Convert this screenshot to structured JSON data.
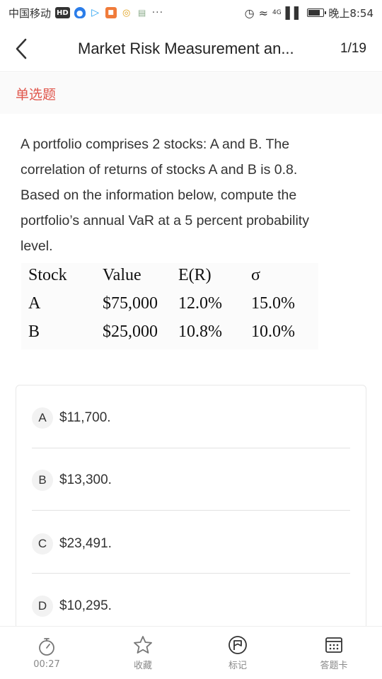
{
  "status_bar": {
    "carrier": "中国移动",
    "hd_badge": "HD",
    "more": "···",
    "network": "4G",
    "time": "晚上8:54",
    "battery_level": 0.85
  },
  "header": {
    "title": "Market Risk Measurement  an...",
    "page_count": "1/19"
  },
  "question_type": "单选题",
  "question": {
    "lines": [
      "A portfolio comprises 2 stocks: A and B. The",
      "correlation of returns of stocks A and B is 0.8.",
      "Based on the information below, compute the",
      "portfolio’s annual VaR at a 5 percent probability",
      "level."
    ],
    "table": {
      "headers": [
        "Stock",
        "Value",
        "E(R)",
        "σ"
      ],
      "rows": [
        [
          "A",
          "$75,000",
          "12.0%",
          "15.0%"
        ],
        [
          "B",
          "$25,000",
          "10.8%",
          "10.0%"
        ]
      ]
    }
  },
  "options": [
    {
      "letter": "A",
      "text": "$11,700."
    },
    {
      "letter": "B",
      "text": "$13,300."
    },
    {
      "letter": "C",
      "text": "$23,491."
    },
    {
      "letter": "D",
      "text": "$10,295."
    }
  ],
  "bottom_bar": {
    "timer": "00:27",
    "favorite": "收藏",
    "mark": "标记",
    "answer_sheet": "答题卡"
  },
  "colors": {
    "accent_red": "#e0564c",
    "icon_gray": "#777777"
  },
  "icons": {
    "timer": "stopwatch-icon",
    "favorite": "star-icon",
    "mark": "flag-circle-icon",
    "answer_sheet": "grid-card-icon"
  }
}
